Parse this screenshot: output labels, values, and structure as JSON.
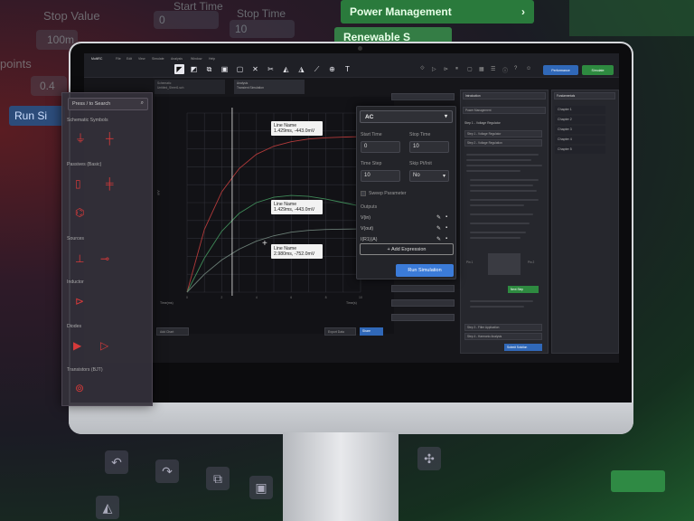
{
  "background": {
    "left_labels": [
      "Stop Value",
      "100m",
      "points",
      "0.4"
    ],
    "left_button": "Run Si",
    "top_labels": [
      "Start Time",
      "Stop Time",
      "0",
      "10"
    ],
    "green_buttons": [
      "Power Management",
      "Renewable S"
    ]
  },
  "toolbar": {
    "app_name": "MultiRC",
    "menus": [
      "File",
      "Edit",
      "View",
      "Simulate",
      "Analysis",
      "Window",
      "Help"
    ],
    "tools": [
      "select-tool",
      "wire-tool",
      "copy-tool",
      "paste-tool",
      "cut-tool",
      "delete-tool",
      "flip-tool",
      "rotate-tool",
      "probe-tool",
      "crosshair-tool",
      "text-tool"
    ],
    "sim_button": "Pe​rformance",
    "run_button": "Simulate"
  },
  "tabs": [
    {
      "label": "Schematic",
      "sub": "Untitled_Sheet1.sch"
    },
    {
      "label": "Analysis",
      "sub": "Transient Simulation"
    }
  ],
  "chart_data": {
    "type": "line",
    "x_ticks": [
      "0",
      "1",
      "2",
      "3",
      "4",
      "5",
      "6",
      "7",
      "8",
      "9",
      "10"
    ],
    "xlabel_left": "Time(ms)",
    "xlabel_right": "Time(s)",
    "ylabel": "mV",
    "series": [
      {
        "color": "#b23a3a",
        "values": [
          0,
          350,
          560,
          690,
          770,
          815,
          840,
          855,
          862,
          866,
          868
        ]
      },
      {
        "color": "#3f8a58",
        "values": [
          0,
          190,
          340,
          440,
          500,
          530,
          540,
          535,
          520,
          500,
          480
        ]
      },
      {
        "color": "#6a7d75",
        "values": [
          0,
          100,
          180,
          240,
          285,
          315,
          335,
          345,
          350,
          352,
          353
        ]
      }
    ],
    "cursor_x": 2.6,
    "tooltips": [
      {
        "title": "Line Name",
        "value": "1.429ms, -443.0mV"
      },
      {
        "title": "Line Name",
        "value": "1.429ms, -443.0mV"
      },
      {
        "title": "Line Name",
        "value": "2.980ms, -752.0mV"
      }
    ],
    "ylim": [
      0,
      1000
    ],
    "xlim": [
      0,
      10
    ],
    "grid": true
  },
  "chart_footer": {
    "left_button": "Add Chart",
    "right_button1": "Export Data",
    "right_button2": "Share"
  },
  "popup": {
    "mode": "AC",
    "start_time_label": "Start Time",
    "start_time_value": "0",
    "stop_time_label": "Stop Time",
    "stop_time_value": "10",
    "time_step_label": "Time Step",
    "time_step_value": "10",
    "skip_pt_label": "Skip Pt/Init",
    "skip_pt_value": "No",
    "sweep_label": "Sweep Parameter",
    "outputs_label": "Outputs",
    "outputs": [
      "V(in)",
      "V(out)",
      "I(R1)(A)"
    ],
    "add_expression": "+ Add Expression",
    "run": "Run Simulation"
  },
  "left_panel": {
    "search_placeholder": "Press / to Search",
    "sections": [
      "Schematic Symbols",
      "Passives (Basic)",
      "Sources",
      "Inductor",
      "Diodes",
      "Transistors (BJT)"
    ]
  },
  "right_panel": {
    "header": "Introduction",
    "power_dropdown": "Power Management",
    "step_title": "Step 1 - Voltage Regulator",
    "step1": "Step 1 - Voltage Regulator",
    "step2": "Step 2 - Voltage Regulation",
    "next_step": "Next Step",
    "bottom_step1": "Step 3 - Filter Application",
    "bottom_step2": "Step 4 - Harmonic Analysis",
    "bottom_button": "Submit Solution",
    "net_labels": [
      "Pin 1",
      "Pin 2"
    ]
  },
  "chapters": {
    "header": "Fundamentals",
    "items": [
      "Chapter 1",
      "Chapter 2",
      "Chapter 3",
      "Chapter 4",
      "Chapter 5"
    ]
  },
  "colors": {
    "accent_green": "#2e8a40",
    "accent_blue": "#3b7bd8",
    "accent_red": "#d53a3a"
  }
}
